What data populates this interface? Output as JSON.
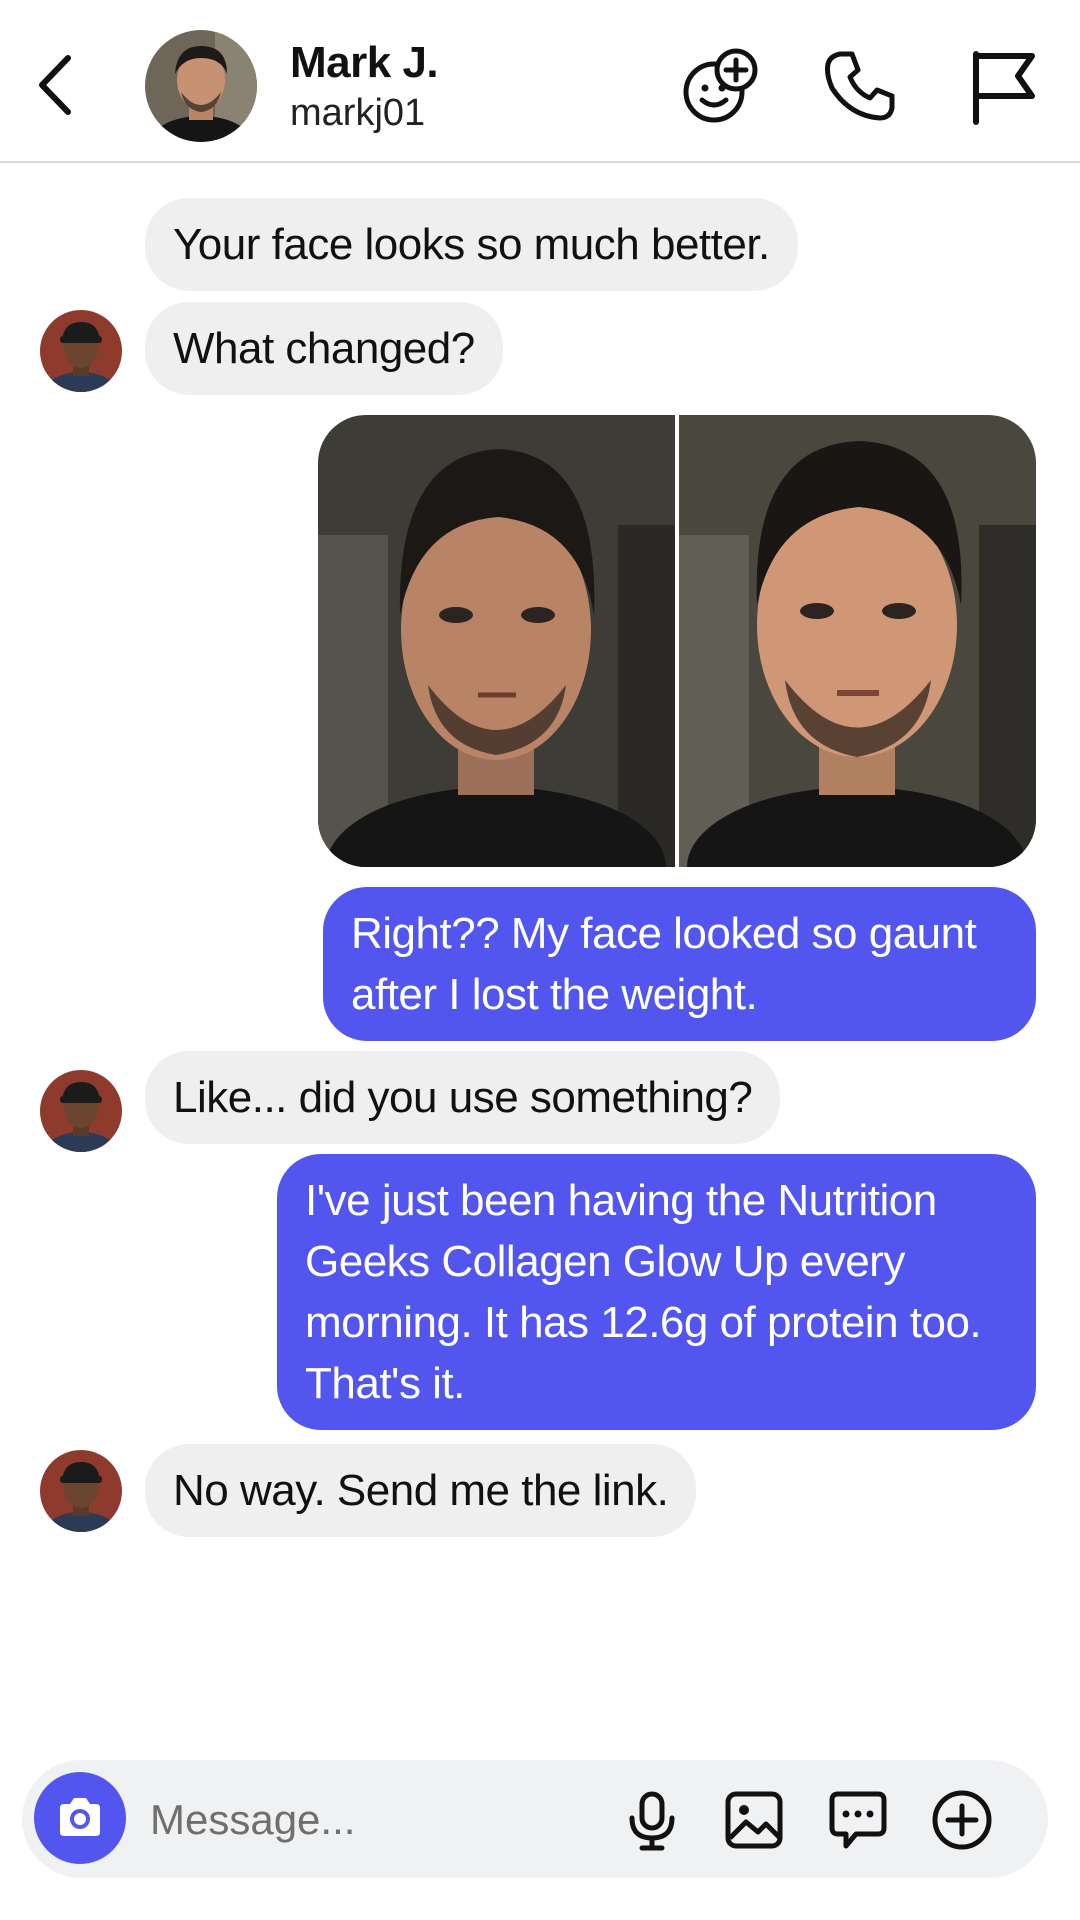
{
  "header": {
    "name": "Mark J.",
    "username": "markj01",
    "icons": [
      "chevron-left-icon",
      "add-friend-sticker-icon",
      "phone-icon",
      "flag-icon"
    ]
  },
  "messages": [
    {
      "direction": "incoming",
      "text": "Your face looks so much better."
    },
    {
      "direction": "incoming",
      "text": "What changed?"
    },
    {
      "direction": "outgoing",
      "type": "image-pair",
      "alt": "before and after face photos"
    },
    {
      "direction": "outgoing",
      "text": "Right?? My face looked so gaunt after I lost the weight."
    },
    {
      "direction": "incoming",
      "text": "Like... did you use something?"
    },
    {
      "direction": "outgoing",
      "text": "I've just been having the Nutrition Geeks Collagen Glow Up every morning. It has 12.6g of protein too. That's it."
    },
    {
      "direction": "incoming",
      "text": "No way. Send me the link."
    }
  ],
  "composer": {
    "placeholder": "Message...",
    "icons": [
      "camera-icon",
      "microphone-icon",
      "image-icon",
      "chat-bubble-icon",
      "add-circle-icon"
    ]
  },
  "colors": {
    "outgoing_bubble": "#5256ef",
    "incoming_bubble": "#efefef",
    "accent": "#5256ef"
  }
}
